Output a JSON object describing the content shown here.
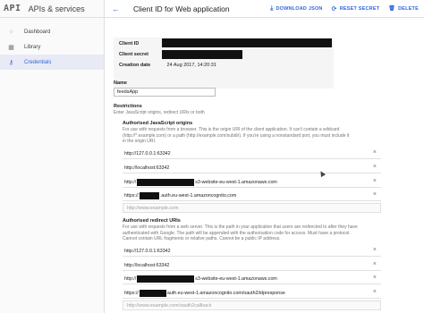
{
  "sidebar": {
    "logo": "API",
    "title": "APIs & services",
    "items": [
      {
        "label": "Dashboard",
        "icon": "dashboard-icon",
        "glyph": "⁘"
      },
      {
        "label": "Library",
        "icon": "library-icon",
        "glyph": "▦"
      },
      {
        "label": "Credentials",
        "icon": "key-icon",
        "glyph": "⚷",
        "active": true
      }
    ]
  },
  "header": {
    "back_glyph": "←",
    "title": "Client ID for Web application",
    "actions": [
      {
        "label": "DOWNLOAD JSON",
        "glyph": "⤓"
      },
      {
        "label": "RESET SECRET",
        "glyph": "⟳"
      },
      {
        "label": "DELETE",
        "glyph": "🗑"
      }
    ]
  },
  "info": {
    "client_id_label": "Client ID",
    "client_secret_label": "Client secret",
    "creation_date_label": "Creation date",
    "creation_date_value": "24 Aug 2017, 14:20:31"
  },
  "name": {
    "label": "Name",
    "value": "feedsApp"
  },
  "restrictions": {
    "label": "Restrictions",
    "hint": "Enter JavaScript origins, redirect URIs or both"
  },
  "js_origins": {
    "title": "Authorised JavaScript origins",
    "hint": [
      "For use with requests from a browser. This is the origin URI of the client application. It can't contain a wildcard",
      "(http://*.example.com) or a path (http://example.com/subdir). If you're using a nonstandard port, you must include it",
      "in the origin URI."
    ],
    "uris": [
      {
        "text": "http://127.0.0.1:63342"
      },
      {
        "text": "http://localhost:63342"
      },
      {
        "text": "s3-website-eu-west-1.amazonaws.com",
        "prefix": "http://"
      },
      {
        "text": ".auth.eu-west-1.amazoncognito.com",
        "prefix": "https://"
      }
    ],
    "placeholder": "http://www.example.com"
  },
  "redirect_uris": {
    "title": "Authorised redirect URIs",
    "hint": [
      "For use with requests from a web server. This is the path in your application that users are redirected to after they have",
      "authenticated with Google. The path will be appended with the authorisation code for access. Must have a protocol.",
      "Cannot contain URL fragments or relative paths. Cannot be a public IP address."
    ],
    "uris": [
      {
        "text": "http://127.0.0.1:63342"
      },
      {
        "text": "http://localhost:63342"
      },
      {
        "text": "s3-website-eu-west-1.amazonaws.com",
        "prefix": "http://"
      },
      {
        "text": "auth.eu-west-1.amazoncognito.com/oauth2/idpresponse",
        "prefix": "https://"
      }
    ],
    "placeholder": "http://www.example.com/oauth2callback"
  },
  "remove_glyph": "×"
}
